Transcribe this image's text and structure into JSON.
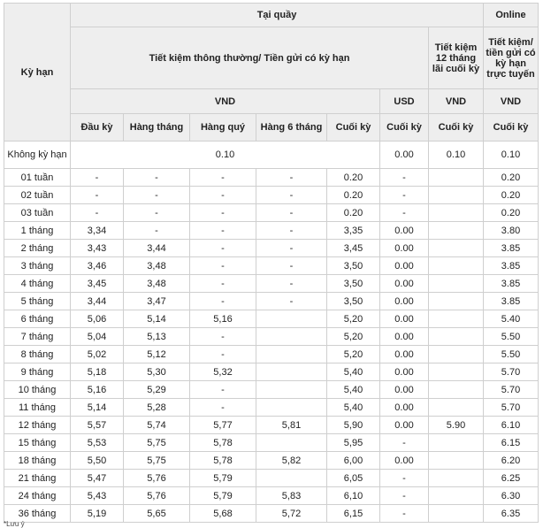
{
  "header": {
    "term": "Kỳ hạn",
    "at_counter": "Tại quầy",
    "online": "Online",
    "regular_savings": "Tiết kiệm thông thường/ Tiền gửi có kỳ hạn",
    "savings_12m": "Tiết kiệm 12 tháng lãi cuối kỳ",
    "online_savings": "Tiết kiệm/ tiền gửi có kỳ hạn trực tuyến",
    "vnd": "VND",
    "usd": "USD",
    "col_upfront": "Đầu kỳ",
    "col_monthly": "Hàng tháng",
    "col_quarterly": "Hàng quý",
    "col_6month": "Hàng 6 tháng",
    "col_end": "Cuối kỳ",
    "col_usd_end": "Cuối kỳ",
    "col_12m_end": "Cuối kỳ",
    "col_online_end": "Cuối kỳ"
  },
  "demand_row": {
    "term": "Không kỳ hạn",
    "vnd_rate": "0.10",
    "usd_rate": "0.00",
    "savings_12m": "0.10",
    "online": "0.10"
  },
  "rows": [
    {
      "term": "01 tuần",
      "upfront": "-",
      "monthly": "-",
      "quarterly": "-",
      "six_month": "-",
      "end": "0.20",
      "usd": "-",
      "s12": "",
      "online": "0.20"
    },
    {
      "term": "02 tuần",
      "upfront": "-",
      "monthly": "-",
      "quarterly": "-",
      "six_month": "-",
      "end": "0.20",
      "usd": "-",
      "s12": "",
      "online": "0.20"
    },
    {
      "term": "03 tuần",
      "upfront": "-",
      "monthly": "-",
      "quarterly": "-",
      "six_month": "-",
      "end": "0.20",
      "usd": "-",
      "s12": "",
      "online": "0.20"
    },
    {
      "term": "1 tháng",
      "upfront": "3,34",
      "monthly": "-",
      "quarterly": "-",
      "six_month": "-",
      "end": "3,35",
      "usd": "0.00",
      "s12": "",
      "online": "3.80"
    },
    {
      "term": "2 tháng",
      "upfront": "3,43",
      "monthly": "3,44",
      "quarterly": "-",
      "six_month": "-",
      "end": "3,45",
      "usd": "0.00",
      "s12": "",
      "online": "3.85"
    },
    {
      "term": "3 tháng",
      "upfront": "3,46",
      "monthly": "3,48",
      "quarterly": "-",
      "six_month": "-",
      "end": "3,50",
      "usd": "0.00",
      "s12": "",
      "online": "3.85"
    },
    {
      "term": "4 tháng",
      "upfront": "3,45",
      "monthly": "3,48",
      "quarterly": "-",
      "six_month": "-",
      "end": "3,50",
      "usd": "0.00",
      "s12": "",
      "online": "3.85"
    },
    {
      "term": "5 tháng",
      "upfront": "3,44",
      "monthly": "3,47",
      "quarterly": "-",
      "six_month": "-",
      "end": "3,50",
      "usd": "0.00",
      "s12": "",
      "online": "3.85"
    },
    {
      "term": "6 tháng",
      "upfront": "5,06",
      "monthly": "5,14",
      "quarterly": "5,16",
      "six_month": "",
      "end": "5,20",
      "usd": "0.00",
      "s12": "",
      "online": "5.40"
    },
    {
      "term": "7  tháng",
      "upfront": "5,04",
      "monthly": "5,13",
      "quarterly": "-",
      "six_month": "",
      "end": "5,20",
      "usd": "0.00",
      "s12": "",
      "online": "5.50"
    },
    {
      "term": "8 tháng",
      "upfront": "5,02",
      "monthly": "5,12",
      "quarterly": "-",
      "six_month": "",
      "end": "5,20",
      "usd": "0.00",
      "s12": "",
      "online": "5.50"
    },
    {
      "term": "9 tháng",
      "upfront": "5,18",
      "monthly": "5,30",
      "quarterly": "5,32",
      "six_month": "",
      "end": "5,40",
      "usd": "0.00",
      "s12": "",
      "online": "5.70"
    },
    {
      "term": "10 tháng",
      "upfront": "5,16",
      "monthly": "5,29",
      "quarterly": "-",
      "six_month": "",
      "end": "5,40",
      "usd": "0.00",
      "s12": "",
      "online": "5.70"
    },
    {
      "term": "11 tháng",
      "upfront": "5,14",
      "monthly": "5,28",
      "quarterly": "-",
      "six_month": "",
      "end": "5,40",
      "usd": "0.00",
      "s12": "",
      "online": "5.70"
    },
    {
      "term": "12 tháng",
      "upfront": "5,57",
      "monthly": "5,74",
      "quarterly": "5,77",
      "six_month": "5,81",
      "end": "5,90",
      "usd": "0.00",
      "s12": "5.90",
      "online": "6.10"
    },
    {
      "term": "15 tháng",
      "upfront": "5,53",
      "monthly": "5,75",
      "quarterly": "5,78",
      "six_month": "",
      "end": "5,95",
      "usd": "-",
      "s12": "",
      "online": "6.15"
    },
    {
      "term": "18 tháng",
      "upfront": "5,50",
      "monthly": "5,75",
      "quarterly": "5,78",
      "six_month": "5,82",
      "end": "6,00",
      "usd": "0.00",
      "s12": "",
      "online": "6.20"
    },
    {
      "term": "21 tháng",
      "upfront": "5,47",
      "monthly": "5,76",
      "quarterly": "5,79",
      "six_month": "",
      "end": "6,05",
      "usd": "-",
      "s12": "",
      "online": "6.25"
    },
    {
      "term": "24 tháng",
      "upfront": "5,43",
      "monthly": "5,76",
      "quarterly": "5,79",
      "six_month": "5,83",
      "end": "6,10",
      "usd": "-",
      "s12": "",
      "online": "6.30"
    },
    {
      "term": "36 tháng",
      "upfront": "5,19",
      "monthly": "5,65",
      "quarterly": "5,68",
      "six_month": "5,72",
      "end": "6,15",
      "usd": "-",
      "s12": "",
      "online": "6.35"
    }
  ],
  "footer_note": "*Lưu ý"
}
